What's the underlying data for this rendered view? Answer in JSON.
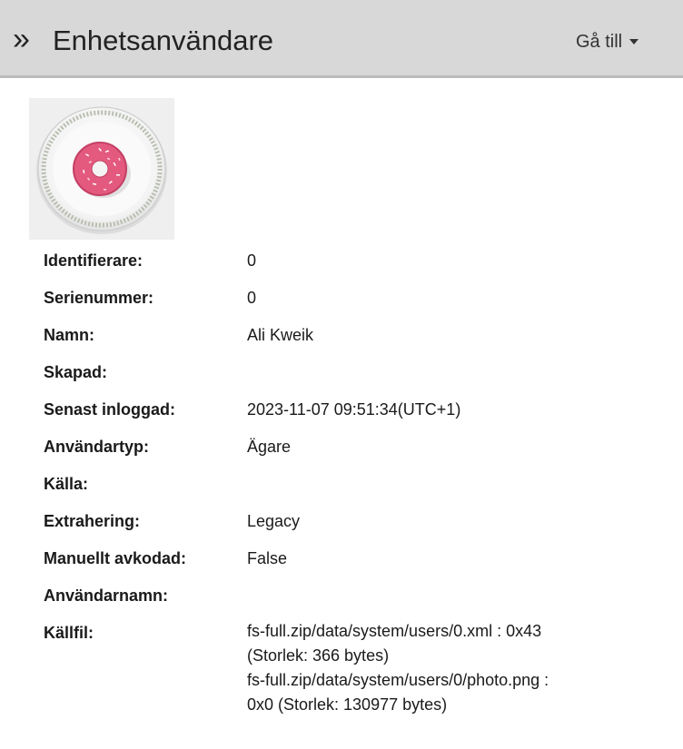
{
  "header": {
    "chevron": "»",
    "title": "Enhetsanvändare",
    "goto_label": "Gå till"
  },
  "icons": {
    "chevron": "double-chevron-right-icon",
    "dropdown": "caret-down-icon"
  },
  "colors": {
    "header_bg": "#d8d8d8",
    "donut_pink": "#e8587c"
  },
  "props": [
    {
      "label": "Identifierare:",
      "value": "0"
    },
    {
      "label": "Serienummer:",
      "value": "0"
    },
    {
      "label": "Namn:",
      "value": "Ali Kweik"
    },
    {
      "label": "Skapad:",
      "value": ""
    },
    {
      "label": "Senast inloggad:",
      "value": "2023-11-07 09:51:34(UTC+1)"
    },
    {
      "label": "Användartyp:",
      "value": "Ägare"
    },
    {
      "label": "Källa:",
      "value": ""
    },
    {
      "label": "Extrahering:",
      "value": "Legacy"
    },
    {
      "label": "Manuellt avkodad:",
      "value": "False"
    },
    {
      "label": "Användarnamn:",
      "value": ""
    }
  ],
  "source": {
    "label": "Källfil:",
    "lines": [
      "fs-full.zip/data/system/users/0.xml : 0x43",
      "(Storlek: 366 bytes)",
      "fs-full.zip/data/system/users/0/photo.png :",
      "0x0 (Storlek: 130977 bytes)"
    ]
  }
}
